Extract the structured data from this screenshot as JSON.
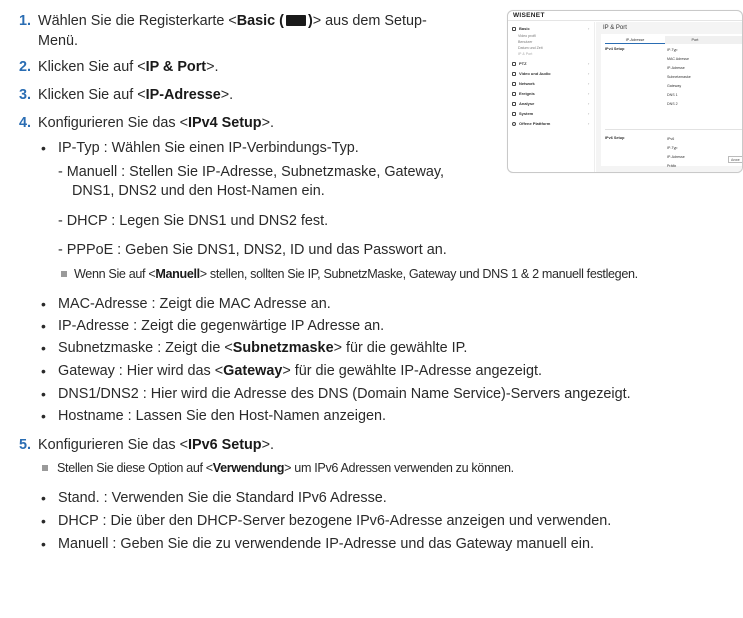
{
  "steps": {
    "s1": {
      "num": "1.",
      "pre": "Wählen Sie die Registerkarte <",
      "bold": "Basic (",
      "bold_end": ")",
      "post": "> aus dem Setup-",
      "cont": "Menü."
    },
    "s2": {
      "num": "2.",
      "pre": "Klicken Sie auf <",
      "bold": "IP & Port",
      "post": ">."
    },
    "s3": {
      "num": "3.",
      "pre": "Klicken Sie auf <",
      "bold": "IP-Adresse",
      "post": ">."
    },
    "s4": {
      "num": "4.",
      "pre": "Konfigurieren Sie das <",
      "bold": "IPv4 Setup",
      "post": ">."
    },
    "s5": {
      "num": "5.",
      "pre": "Konfigurieren Sie das <",
      "bold": "IPv6 Setup",
      "post": ">."
    }
  },
  "ipv4": {
    "ip_type": "IP-Typ : Wählen Sie einen IP-Verbindungs-Typ.",
    "manual_1": "- Manuell : Stellen Sie IP-Adresse, Subnetzmaske, Gateway,",
    "manual_2": "DNS1, DNS2 und den Host-Namen ein.",
    "dhcp": "- DHCP : Legen Sie DNS1 und DNS2 fest.",
    "pppoe": "- PPPoE : Geben Sie DNS1, DNS2, ID und das Passwort an.",
    "note_pre": "Wenn Sie auf <",
    "note_bold": "Manuell",
    "note_post": "> stellen, sollten Sie IP, SubnetzMaske, Gateway und DNS 1 & 2 manuell festlegen.",
    "mac": "MAC-Adresse : Zeigt die MAC Adresse an.",
    "ip": "IP-Adresse : Zeigt die gegenwärtige IP Adresse an.",
    "subnet_pre": "Subnetzmaske : Zeigt die <",
    "subnet_bold": "Subnetzmaske",
    "subnet_post": "> für die gewählte IP.",
    "gw_pre": "Gateway : Hier wird das <",
    "gw_bold": "Gateway",
    "gw_post": "> für die gewählte IP-Adresse angezeigt.",
    "dns": "DNS1/DNS2 : Hier wird die Adresse des DNS (Domain Name Service)-Servers angezeigt.",
    "host": "Hostname : Lassen Sie den Host-Namen anzeigen."
  },
  "ipv6": {
    "note_pre": "Stellen Sie diese Option auf <",
    "note_bold": "Verwendung",
    "note_post": "> um IPv6 Adressen verwenden zu können.",
    "std": "Stand. : Verwenden Sie die Standard IPv6 Adresse.",
    "dhcp": "DHCP : Die über den DHCP-Server bezogene IPv6-Adresse anzeigen und verwenden.",
    "manual": "Manuell : Geben Sie die zu verwendende IP-Adresse und das Gateway manuell ein."
  },
  "screenshot": {
    "brand": "WISENET",
    "sidebar": {
      "basic": "Basic",
      "video_profile": "Video profil",
      "users": "Benutzer",
      "datetime": "Datum und Zeit",
      "ip_port": "IP & Port",
      "ptz": "PTZ",
      "video_audio": "Video und Audio",
      "network": "Network",
      "events": "Ereignis",
      "analysis": "Analyse",
      "system": "System",
      "open_platform": "Offene Plattform",
      "chevron": "›"
    },
    "title": "IP & Port",
    "tabs": [
      "IP-Adresse",
      "Port"
    ],
    "ipv4_label": "IPv4 Setup",
    "ipv4_rows": [
      "IP-Typ",
      "MAC Adresse",
      "IP-Adresse",
      "Subnetzmaske",
      "Gateway",
      "DNS 1",
      "DNS 2"
    ],
    "ipv6_label": "IPv6 Setup",
    "ipv6_rows": [
      "IPv6",
      "IP-Typ",
      "IP-Adresse",
      "Präfix"
    ],
    "apply": "Anwe"
  }
}
